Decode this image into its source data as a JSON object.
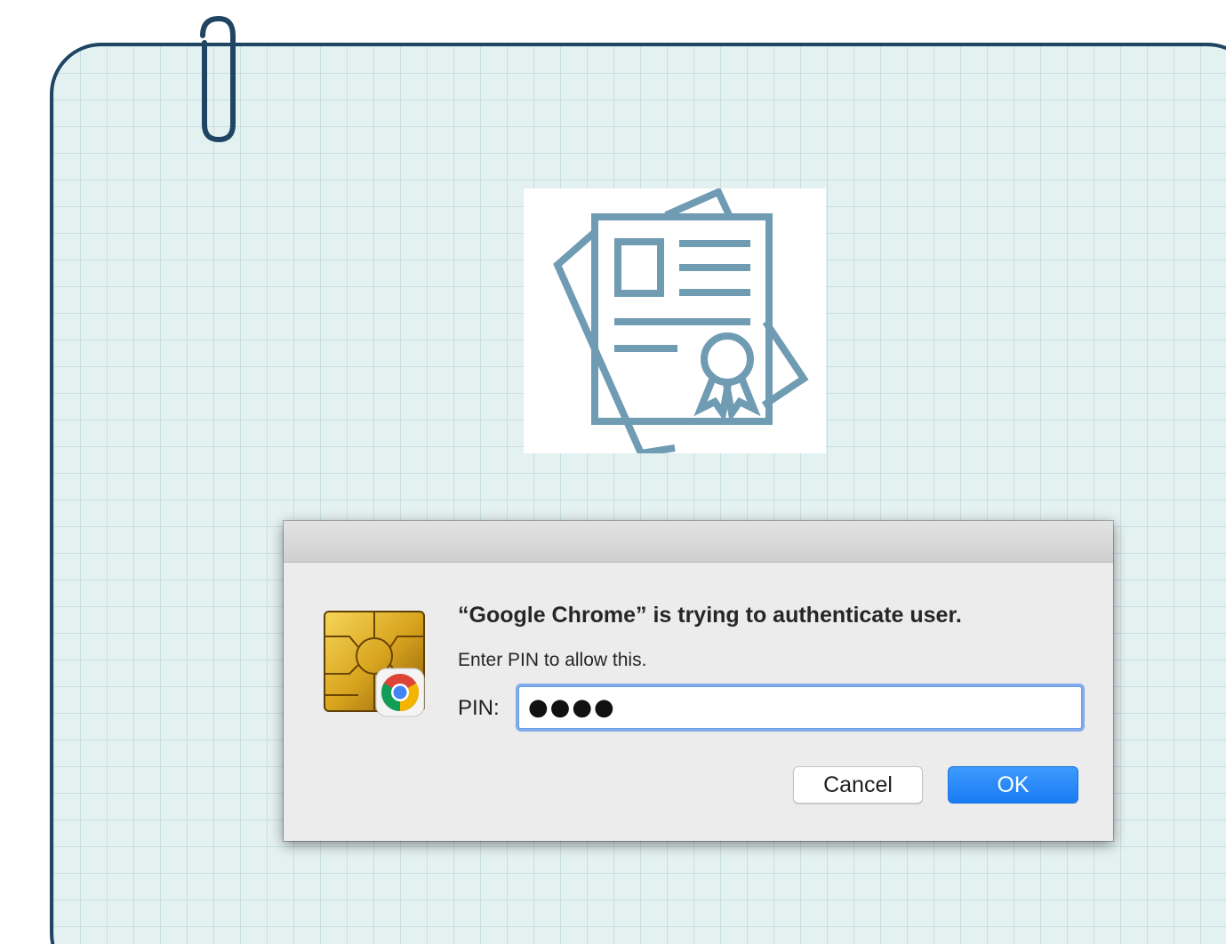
{
  "dialog": {
    "title": "“Google Chrome” is trying to authenticate user.",
    "message": "Enter PIN to allow this.",
    "pin_label": "PIN:",
    "pin_value": "●●●●",
    "cancel_label": "Cancel",
    "ok_label": "OK"
  },
  "icons": {
    "paperclip": "paperclip-icon",
    "certificate": "certificate-document-icon",
    "smart_card": "smart-card-chip-icon",
    "chrome": "chrome-logo-icon"
  },
  "colors": {
    "card_border": "#1f4563",
    "card_background": "#e4f1f1",
    "certificate_stroke": "#6f9bb3",
    "ok_button": "#1a7cf5",
    "focus_ring": "#5e96eb"
  }
}
